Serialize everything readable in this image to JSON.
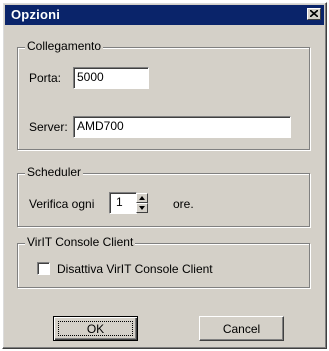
{
  "window": {
    "title": "Opzioni"
  },
  "collegamento": {
    "legend": "Collegamento",
    "porta_label": "Porta:",
    "porta_value": "5000",
    "server_label": "Server:",
    "server_value": "AMD700"
  },
  "scheduler": {
    "legend": "Scheduler",
    "verifica_label": "Verifica ogni",
    "interval_value": "1",
    "unit_label": "ore."
  },
  "console": {
    "legend": "VirIT Console Client",
    "checkbox_label": "Disattiva VirIT Console Client",
    "checked": false
  },
  "buttons": {
    "ok_label": "OK",
    "cancel_label": "Cancel"
  },
  "colors": {
    "titlebar": "#0a246a",
    "face": "#d4d0c8"
  },
  "icons": {
    "close": "close-icon",
    "spin_up": "arrow-up-icon",
    "spin_down": "arrow-down-icon"
  }
}
